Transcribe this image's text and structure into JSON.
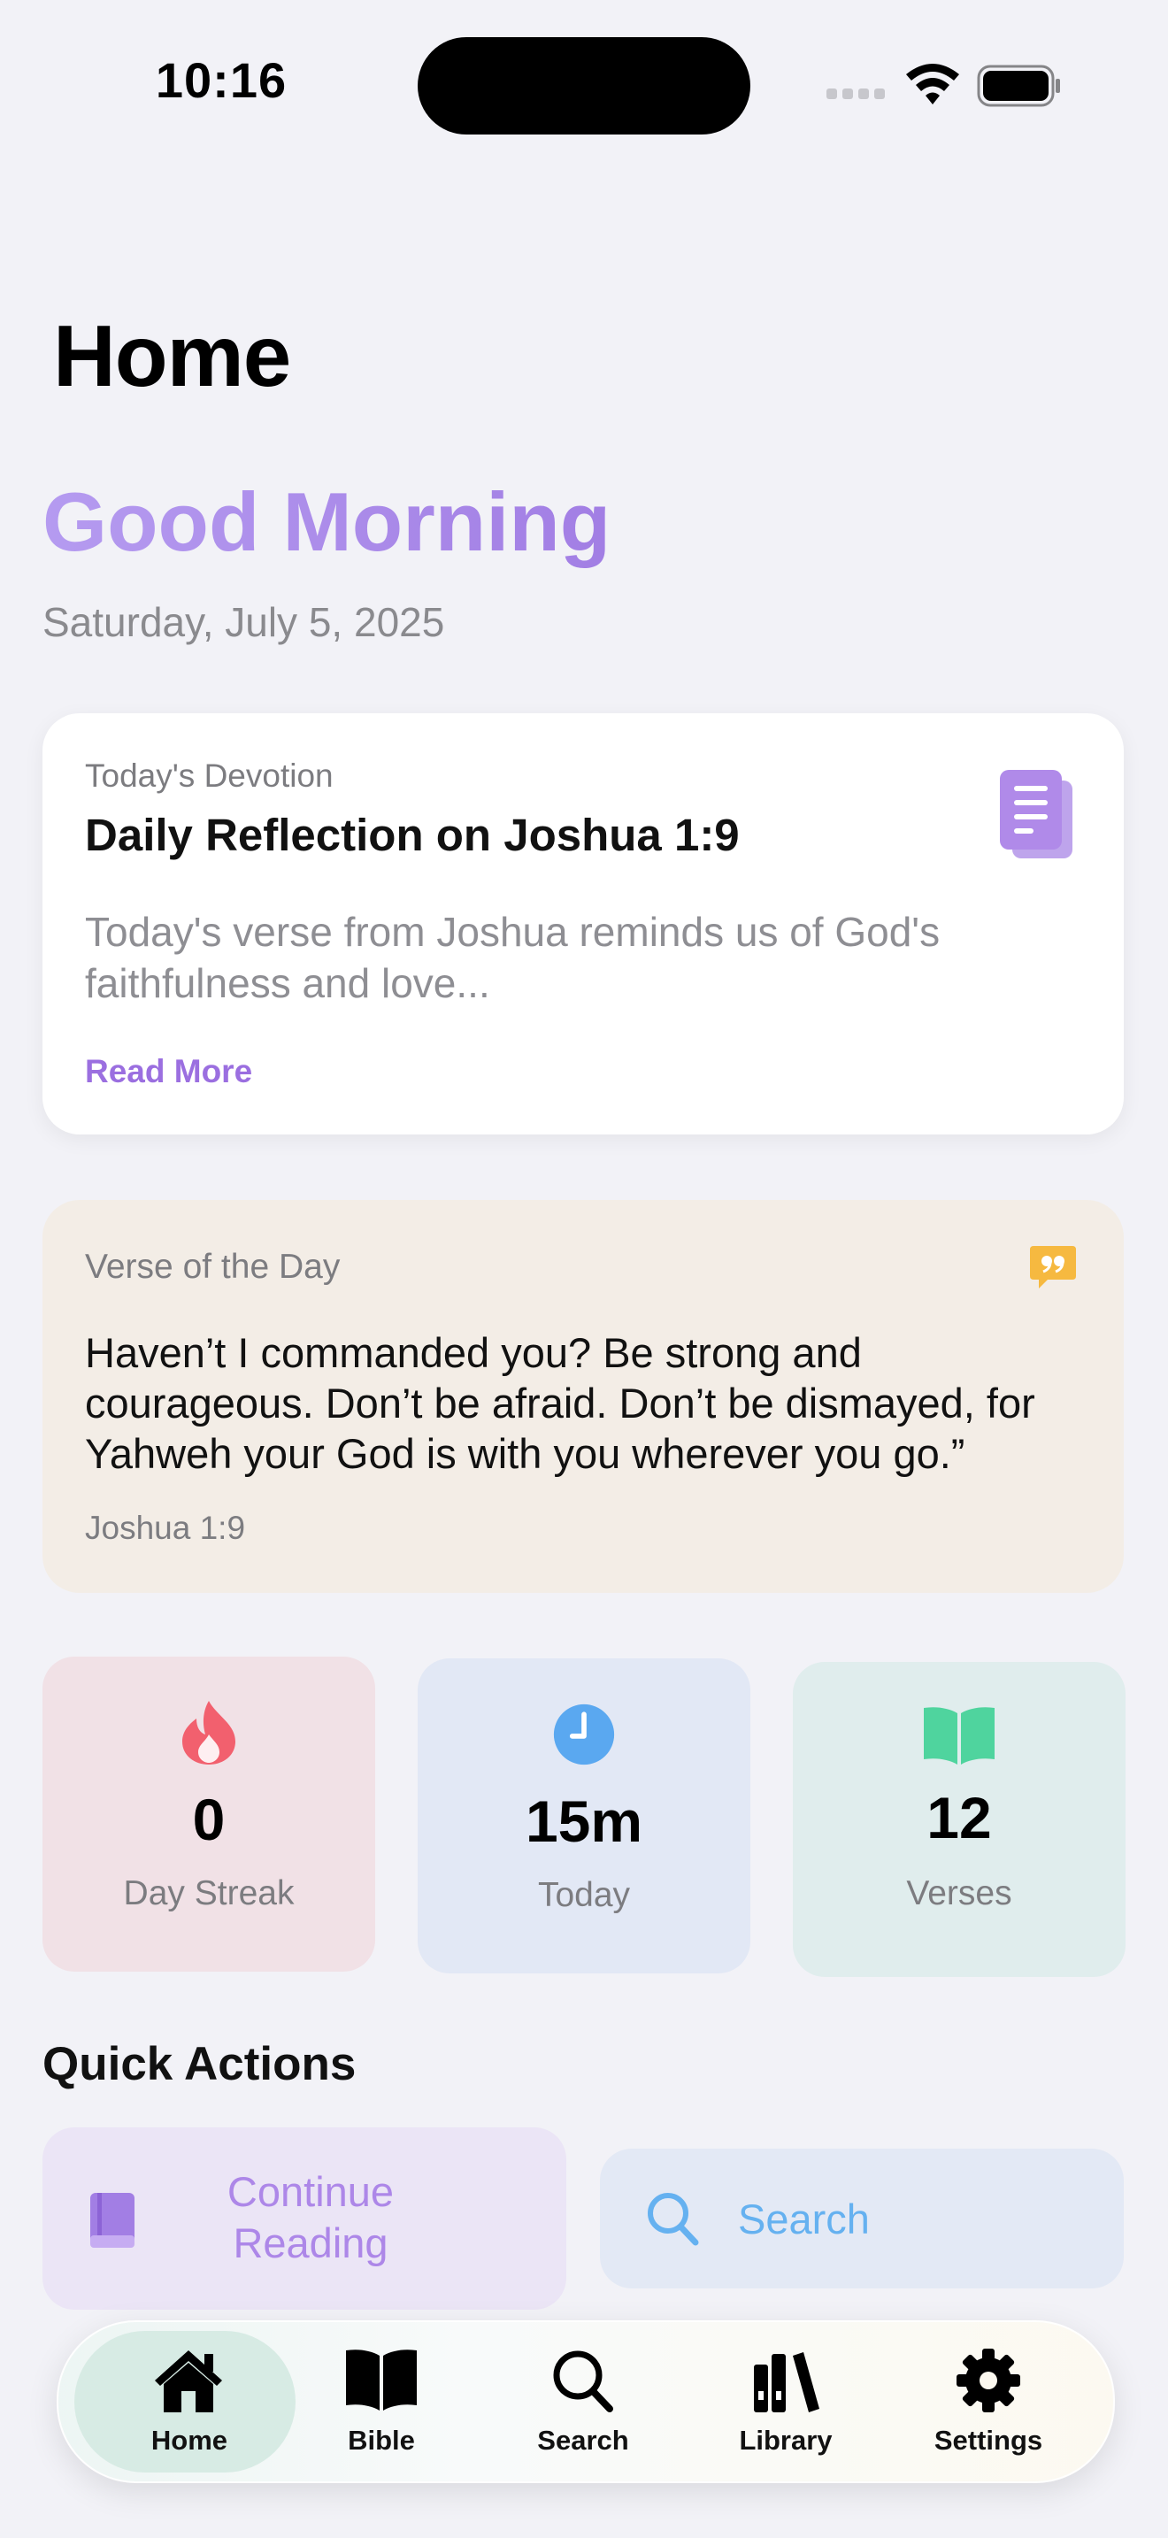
{
  "status_bar": {
    "time": "10:16"
  },
  "page": {
    "title": "Home",
    "greeting": "Good Morning",
    "date": "Saturday, July 5, 2025"
  },
  "devotion": {
    "kicker": "Today's Devotion",
    "title": "Daily Reflection on Joshua 1:9",
    "summary": "Today's verse from Joshua reminds us of God's faithfulness and love...",
    "link": "Read More",
    "icon": "document-icon"
  },
  "verse": {
    "kicker": "Verse of the Day",
    "text": "Haven’t I commanded you? Be strong and courageous. Don’t be afraid. Don’t be dismayed, for Yahweh your God is with you wherever you go.”",
    "reference": "Joshua 1:9",
    "icon": "quote-icon"
  },
  "stats": [
    {
      "value": "0",
      "label": "Day Streak",
      "icon": "flame-icon",
      "color": "#f2606e"
    },
    {
      "value": "15m",
      "label": "Today",
      "icon": "clock-icon",
      "color": "#5aa8f0"
    },
    {
      "value": "12",
      "label": "Verses",
      "icon": "open-book-icon",
      "color": "#4fd49e"
    }
  ],
  "quick_actions": {
    "title": "Quick Actions",
    "items": [
      {
        "label": "Continue Reading",
        "icon": "book-icon",
        "color": "#ad87e8"
      },
      {
        "label": "Search",
        "icon": "magnifier-icon",
        "color": "#65b1f0"
      }
    ]
  },
  "tab_bar": {
    "active": "Home",
    "items": [
      {
        "label": "Home",
        "icon": "house-icon"
      },
      {
        "label": "Bible",
        "icon": "bible-icon"
      },
      {
        "label": "Search",
        "icon": "search-icon"
      },
      {
        "label": "Library",
        "icon": "library-icon"
      },
      {
        "label": "Settings",
        "icon": "gear-icon"
      }
    ]
  },
  "colors": {
    "accent": "#a27ee4",
    "background": "#f2f2f7"
  }
}
